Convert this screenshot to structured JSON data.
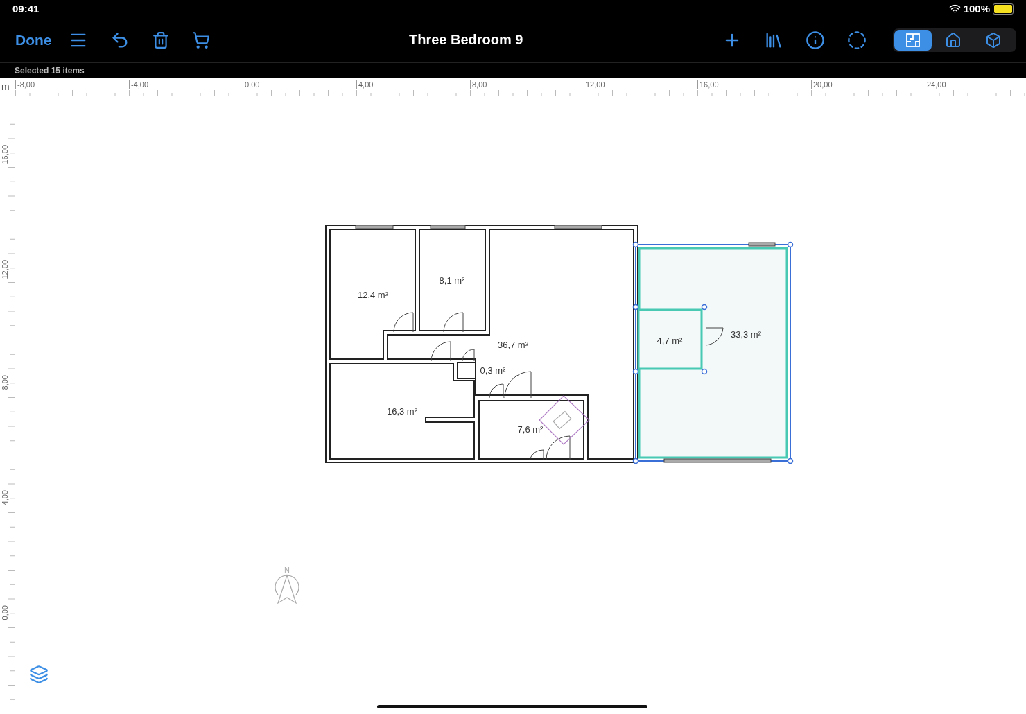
{
  "status_bar": {
    "time": "09:41",
    "battery": "100%"
  },
  "toolbar": {
    "done": "Done",
    "title": "Three Bedroom 9",
    "view_modes": [
      {
        "kind": "plan",
        "selected": true
      },
      {
        "kind": "elevation",
        "selected": false
      },
      {
        "kind": "cube",
        "selected": false
      }
    ]
  },
  "selection_info": "Selected 15 items",
  "ruler": {
    "unit": "m",
    "horizontal": [
      "-8,00",
      "-4,00",
      "0,00",
      "4,00",
      "8,00",
      "12,00",
      "16,00",
      "20,00",
      "24,00"
    ],
    "vertical": [
      "16,00",
      "12,00",
      "8,00",
      "4,00",
      "0,00"
    ]
  },
  "rooms": [
    {
      "area": "12,4 m²",
      "selected": false
    },
    {
      "area": "8,1 m²",
      "selected": false
    },
    {
      "area": "36,7 m²",
      "selected": false
    },
    {
      "area": "16,3 m²",
      "selected": false
    },
    {
      "area": "0,3 m²",
      "selected": false
    },
    {
      "area": "7,6 m²",
      "selected": false
    },
    {
      "area": "33,3 m²",
      "selected": true
    },
    {
      "area": "4,7 m²",
      "selected": true
    }
  ],
  "compass": {
    "label": "N"
  }
}
